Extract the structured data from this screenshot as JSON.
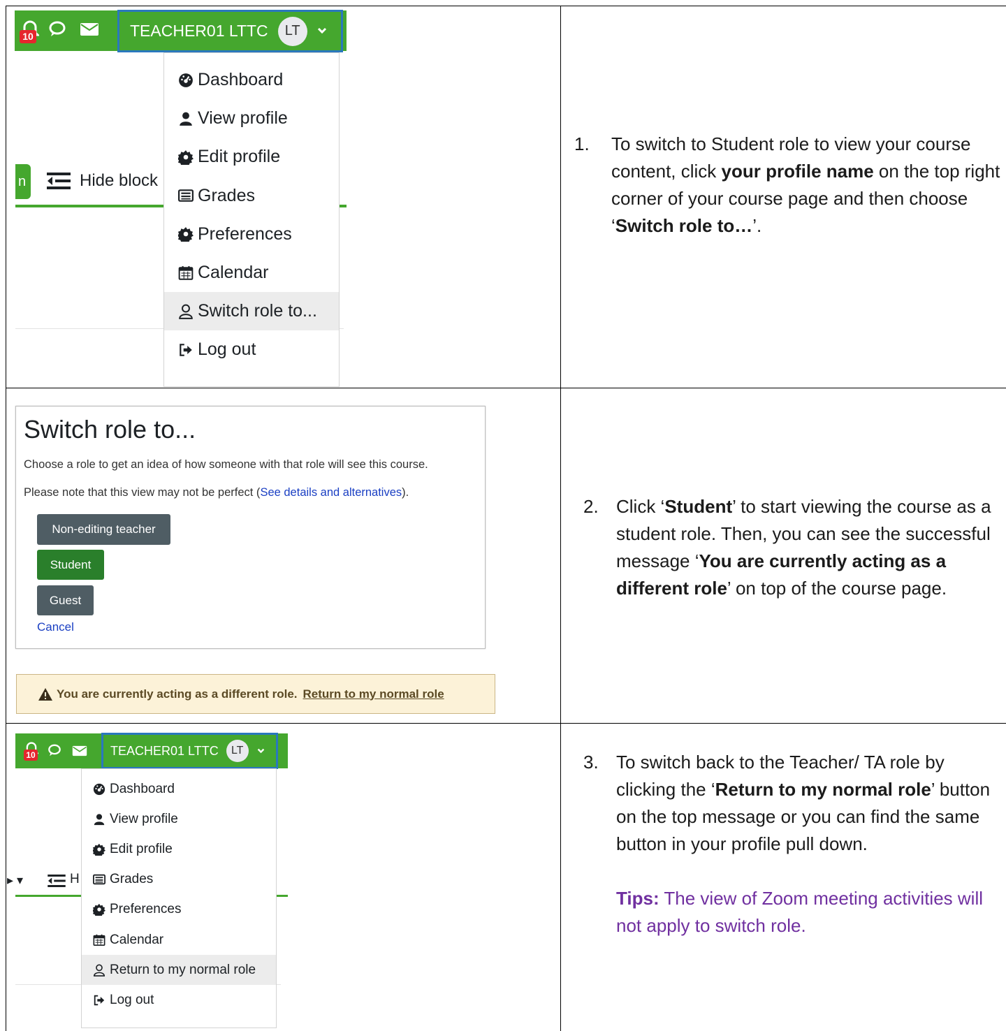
{
  "section1": {
    "notification_count": "10",
    "user_name": "TEACHER01 LTTC",
    "avatar_initials": "LT",
    "hide_blocks_label": "Hide block",
    "left_tab_fragment": "n",
    "menu_items": [
      {
        "label": "Dashboard",
        "icon": "dashboard-icon"
      },
      {
        "label": "View profile",
        "icon": "user-icon"
      },
      {
        "label": "Edit profile",
        "icon": "cog-icon"
      },
      {
        "label": "Grades",
        "icon": "table-icon"
      },
      {
        "label": "Preferences",
        "icon": "cog-icon"
      },
      {
        "label": "Calendar",
        "icon": "calendar-icon"
      },
      {
        "label": "Switch role to...",
        "icon": "user-outline-icon"
      },
      {
        "label": "Log out",
        "icon": "sign-out-icon"
      }
    ],
    "instruction": {
      "number": "1.",
      "text_1": "To switch to Student role to view your course content, click ",
      "bold_1": "your profile name",
      "text_2": " on the top right corner of your course page and then choose ‘",
      "bold_2": "Switch role to…",
      "text_3": "’."
    }
  },
  "section2": {
    "heading": "Switch role to...",
    "desc": "Choose a role to get an idea of how someone with that role will see this course.",
    "note_prefix": "Please note that this view may not be perfect (",
    "note_link": "See details and alternatives",
    "note_suffix": ").",
    "roles": [
      "Non-editing teacher",
      "Student",
      "Guest"
    ],
    "cancel": "Cancel",
    "alert_text": "You are currently acting as a different role.",
    "alert_link": "Return to my normal role",
    "instruction": {
      "number": "2.",
      "text_1": "Click ‘",
      "bold_1": "Student",
      "text_2": "’ to start viewing the course as a student role. Then, you can see the successful message ‘",
      "bold_2": "You are currently acting as a different role",
      "text_3": "’ on top of the course page."
    }
  },
  "section3": {
    "notification_count": "10",
    "user_name": "TEACHER01 LTTC",
    "avatar_initials": "LT",
    "hide_fragment": "H",
    "menu_items": [
      {
        "label": "Dashboard",
        "icon": "dashboard-icon"
      },
      {
        "label": "View profile",
        "icon": "user-icon"
      },
      {
        "label": "Edit profile",
        "icon": "cog-icon"
      },
      {
        "label": "Grades",
        "icon": "table-icon"
      },
      {
        "label": "Preferences",
        "icon": "cog-icon"
      },
      {
        "label": "Calendar",
        "icon": "calendar-icon"
      },
      {
        "label": "Return to my normal role",
        "icon": "user-outline-icon"
      },
      {
        "label": "Log out",
        "icon": "sign-out-icon"
      }
    ],
    "instruction": {
      "number": "3.",
      "text_1": "To switch back to the Teacher/ TA role by clicking the ‘",
      "bold_1": "Return to my normal role",
      "text_2": "’ button on the top message or you can find the same button in your profile pull down.",
      "tips_label": "Tips:",
      "tips_text": " The view of Zoom meeting activities will not apply to switch role."
    }
  },
  "colors": {
    "nav_green": "#45a72e",
    "user_border": "#2a78bd",
    "badge_red": "#e5262d",
    "role_button": "#4f5d64",
    "role_button_active": "#2a7f2b",
    "link_blue": "#1a3fc3",
    "tips_purple": "#7030a0",
    "alert_bg": "#fcf2d8"
  }
}
